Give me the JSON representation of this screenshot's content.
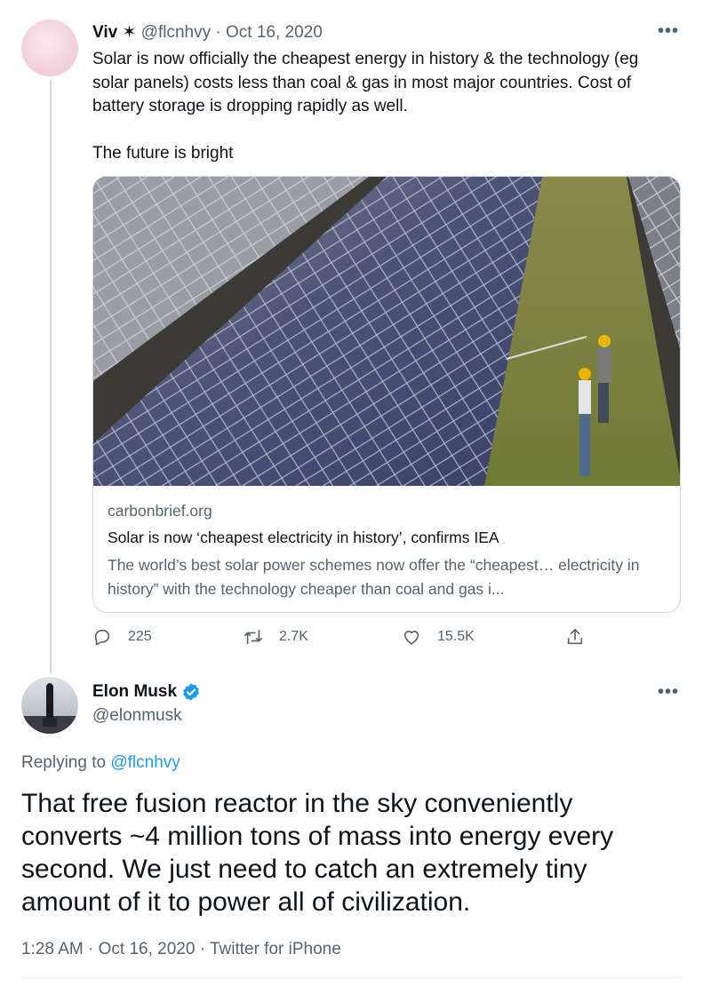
{
  "parent_tweet": {
    "name": "Viv",
    "name_glyph": "✶",
    "handle": "@flcnhvy",
    "separator": "·",
    "date": "Oct 16, 2020",
    "more_icon": "more-horizontal-icon",
    "text": "Solar is now officially the cheapest energy in history & the technology (eg solar panels) costs less than coal & gas in most major countries. Cost of battery storage is dropping rapidly as well.\n\nThe future is bright",
    "card": {
      "image": "solar-panels-photo",
      "domain": "carbonbrief.org",
      "title": "Solar is now ‘cheapest electricity in history’, confirms IEA",
      "description": "The world’s best solar power schemes now offer the “cheapest… electricity in history” with the technology cheaper than coal and gas i..."
    },
    "actions": {
      "replies": "225",
      "retweets": "2.7K",
      "likes": "15.5K",
      "icons": [
        "reply-icon",
        "retweet-icon",
        "like-icon",
        "share-icon"
      ]
    }
  },
  "main_tweet": {
    "name": "Elon Musk",
    "verified_icon": "verified-badge-icon",
    "handle": "@elonmusk",
    "more_icon": "more-horizontal-icon",
    "replying_prefix": "Replying to",
    "replying_to": "@flcnhvy",
    "text": "That free fusion reactor in the sky conveniently converts ~4 million tons of mass into energy every second. We just need to catch an extremely tiny amount of it to power all of civilization.",
    "time": "1:28 AM",
    "separator": "·",
    "date": "Oct 16, 2020",
    "source": "Twitter for iPhone"
  },
  "colors": {
    "text": "#0f1419",
    "secondary": "#536471",
    "link": "#1d9bf0",
    "border": "#cfd9de"
  }
}
